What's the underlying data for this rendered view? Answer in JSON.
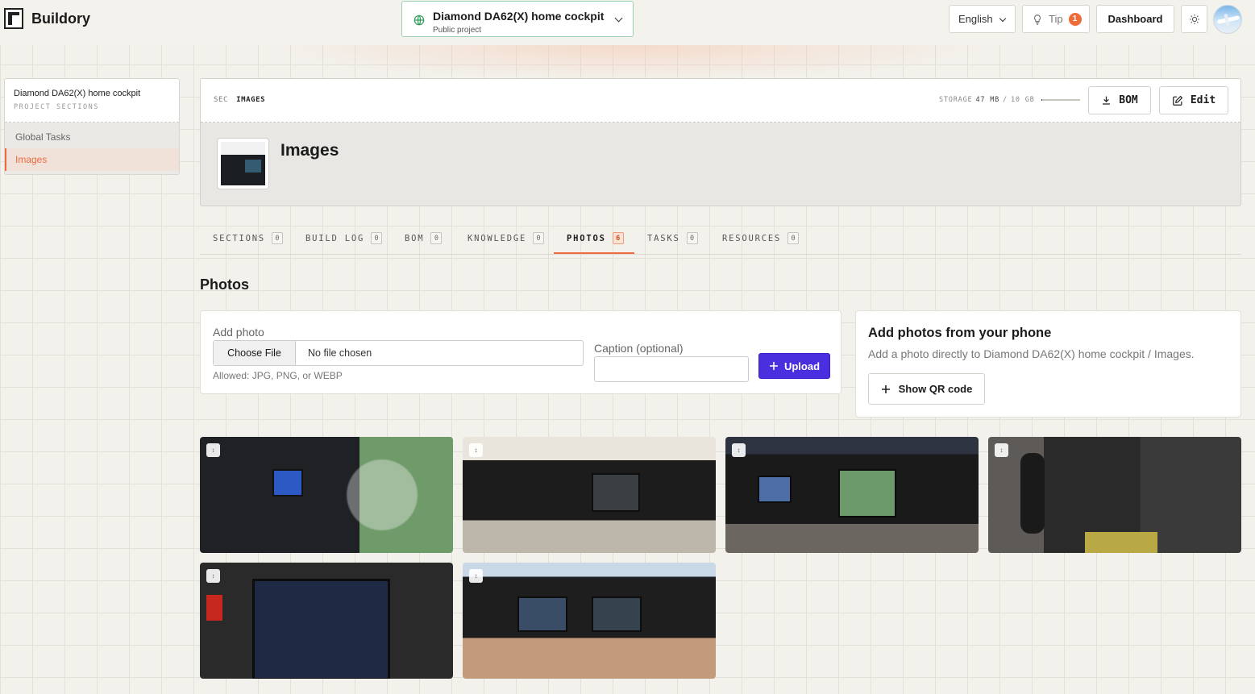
{
  "app": {
    "name": "Buildory"
  },
  "project": {
    "name": "Diamond DA62(X) home cockpit",
    "visibility": "Public project"
  },
  "topbar": {
    "language": "English",
    "tip_label": "Tip",
    "tip_count": "1",
    "dashboard_label": "Dashboard"
  },
  "sidebar": {
    "project_name": "Diamond DA62(X) home cockpit",
    "subtitle": "PROJECT SECTIONS",
    "items": [
      {
        "label": "Global Tasks"
      },
      {
        "label": "Images"
      }
    ]
  },
  "header": {
    "crumb_prefix": "SEC",
    "crumb_section": "IMAGES",
    "storage_label": "STORAGE",
    "storage_used": "47 MB",
    "storage_sep": "/",
    "storage_total": "10 GB",
    "storage_fraction": 0.005,
    "bom_label": "BOM",
    "edit_label": "Edit",
    "title": "Images"
  },
  "tabs": [
    {
      "label": "SECTIONS",
      "count": "0"
    },
    {
      "label": "BUILD LOG",
      "count": "0"
    },
    {
      "label": "BOM",
      "count": "0"
    },
    {
      "label": "KNOWLEDGE",
      "count": "0"
    },
    {
      "label": "PHOTOS",
      "count": "6"
    },
    {
      "label": "TASKS",
      "count": "0"
    },
    {
      "label": "RESOURCES",
      "count": "0"
    }
  ],
  "photos": {
    "title": "Photos",
    "upload": {
      "add_label": "Add photo",
      "choose_file": "Choose File",
      "no_file": "No file chosen",
      "allowed": "Allowed: JPG, PNG, or WEBP",
      "caption_label": "Caption (optional)",
      "upload_label": "Upload"
    },
    "phone": {
      "title": "Add photos from your phone",
      "description": "Add a photo directly to Diamond DA62(X) home cockpit / Images.",
      "qr_label": "Show QR code"
    },
    "handle_glyph": "↕"
  },
  "colors": {
    "accent": "#ef6a3e",
    "primary_button": "#4a2fdf",
    "project_border": "#9bd0b0"
  }
}
